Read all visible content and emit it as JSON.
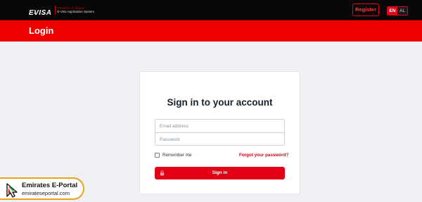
{
  "header": {
    "logo_mark": "EVISA",
    "logo_sub": "ALBANIA",
    "logo_line1": "Republic of Albania",
    "logo_line2": "E-Visa Application System",
    "register_label": "Register",
    "languages": [
      "EN",
      "AL"
    ],
    "active_language": "EN"
  },
  "banner": {
    "title": "Login"
  },
  "login": {
    "title": "Sign in to your account",
    "email_placeholder": "Email address",
    "password_placeholder": "Password",
    "remember_label": "Remember me",
    "forgot_label": "Forgot your password?",
    "submit_label": "Sign in"
  },
  "watermark": {
    "title": "Emirates E-Portal",
    "url": "emirateseportal.com"
  },
  "colors": {
    "brand_red": "#ee0000",
    "button_red": "#e10016",
    "topbar": "#070707",
    "background": "#eef0f4"
  }
}
